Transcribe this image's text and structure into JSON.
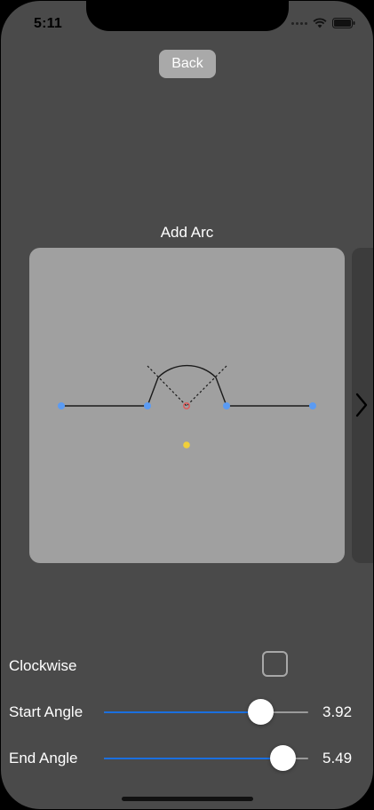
{
  "status_bar": {
    "time": "5:11"
  },
  "nav": {
    "back_label": "Back"
  },
  "title": "Add Arc",
  "controls": {
    "clockwise": {
      "label": "Clockwise",
      "checked": false
    },
    "start_angle": {
      "label": "Start Angle",
      "value": 3.92,
      "value_text": "3.92",
      "fraction": 0.77
    },
    "end_angle": {
      "label": "End Angle",
      "value": 5.49,
      "value_text": "5.49",
      "fraction": 0.88
    }
  },
  "colors": {
    "accent": "#1a6fe0",
    "background": "#4a4a4a",
    "canvas": "#a0a0a0",
    "handle": "#5b9bf3",
    "center_handle": "#f0cf3a",
    "pivot": "#e25656"
  }
}
